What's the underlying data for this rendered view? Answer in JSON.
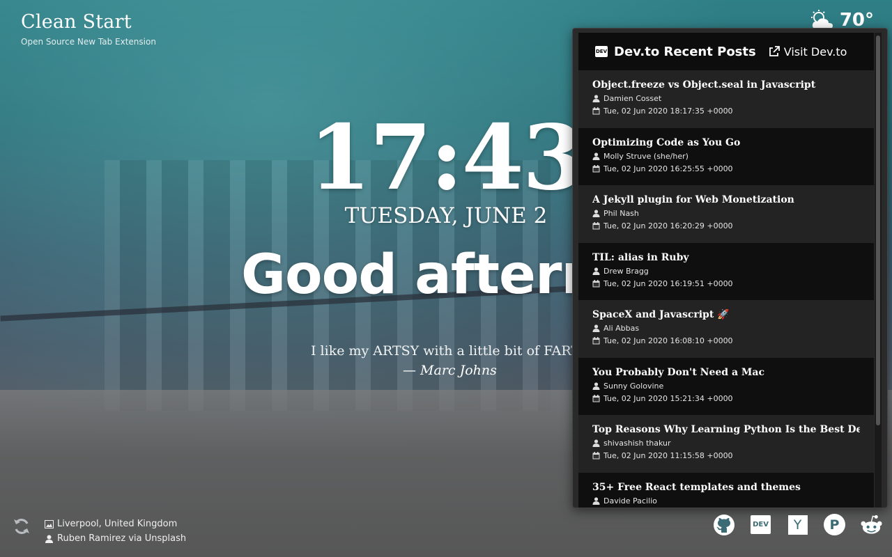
{
  "brand": {
    "title": "Clean Start",
    "subtitle": "Open Source New Tab Extension"
  },
  "weather": {
    "temp": "70°",
    "icon": "partly-cloudy-icon"
  },
  "clock": {
    "time": "17:43",
    "date": "TUESDAY, JUNE 2"
  },
  "greeting": "Good afternoon",
  "quote": {
    "text": "I like my ARTSY with a little bit of FARTSY",
    "author": "— Marc Johns"
  },
  "devto": {
    "title": "Dev.to Recent Posts",
    "badge": "DEV",
    "visit_label": "Visit Dev.to",
    "posts": [
      {
        "title": "Object.freeze vs Object.seal in Javascript",
        "author": "Damien Cosset",
        "date": "Tue, 02 Jun 2020 18:17:35 +0000"
      },
      {
        "title": "Optimizing Code as You Go",
        "author": "Molly Struve (she/her)",
        "date": "Tue, 02 Jun 2020 16:25:55 +0000"
      },
      {
        "title": "A Jekyll plugin for Web Monetization",
        "author": "Phil Nash",
        "date": "Tue, 02 Jun 2020 16:20:29 +0000"
      },
      {
        "title": "TIL: alias in Ruby",
        "author": "Drew Bragg",
        "date": "Tue, 02 Jun 2020 16:19:51 +0000"
      },
      {
        "title": "SpaceX and Javascript 🚀",
        "author": "Ali Abbas",
        "date": "Tue, 02 Jun 2020 16:08:10 +0000"
      },
      {
        "title": "You Probably Don't Need a Mac",
        "author": "Sunny Golovine",
        "date": "Tue, 02 Jun 2020 15:21:34 +0000"
      },
      {
        "title": "Top Reasons Why Learning Python Is the Best Decision",
        "author": "shivashish thakur",
        "date": "Tue, 02 Jun 2020 11:15:58 +0000"
      },
      {
        "title": "35+ Free React templates and themes",
        "author": "Davide Pacilio",
        "date": ""
      }
    ]
  },
  "credits": {
    "location": "Liverpool, United Kingdom",
    "photographer": "Ruben Ramirez",
    "via": "via",
    "source": "Unsplash"
  },
  "links": [
    {
      "name": "github-icon",
      "label": ""
    },
    {
      "name": "devto-icon",
      "label": "DEV"
    },
    {
      "name": "hackernews-icon",
      "label": "Y"
    },
    {
      "name": "producthunt-icon",
      "label": "P"
    },
    {
      "name": "reddit-icon",
      "label": ""
    }
  ]
}
